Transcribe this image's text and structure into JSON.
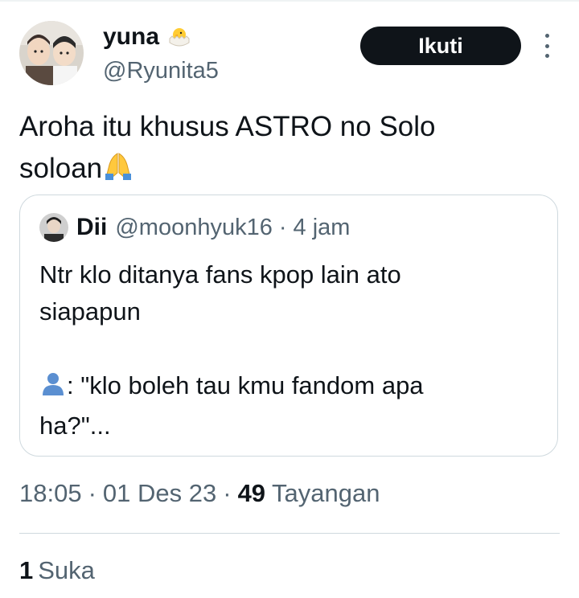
{
  "tweet": {
    "author": {
      "display_name": "yuna",
      "name_emoji": "hatching-chick-icon",
      "handle": "@Ryunita5"
    },
    "follow_label": "Ikuti",
    "text_line1": "Aroha itu khusus ASTRO no Solo",
    "text_line2": "soloan",
    "text_emoji": "folded-hands-icon"
  },
  "quote": {
    "name": "Dii",
    "handle": "@moonhyuk16",
    "separator": "·",
    "time": "4 jam",
    "line1": "Ntr klo ditanya fans kpop lain ato",
    "line2": "siapapun",
    "line3": "",
    "line4": ": \"klo boleh tau kmu fandom apa",
    "line5": "ha?\"...",
    "line4_emoji": "bust-silhouette-icon"
  },
  "meta": {
    "time": "18:05",
    "sep1": "·",
    "date": "01 Des 23",
    "sep2": "·",
    "views": "49",
    "views_label": "Tayangan"
  },
  "engagement": {
    "likes": "1",
    "likes_label": "Suka"
  },
  "colors": {
    "text": "#0f1419",
    "secondary": "#536471",
    "border": "#cfd9de",
    "button_bg": "#0f1419"
  }
}
